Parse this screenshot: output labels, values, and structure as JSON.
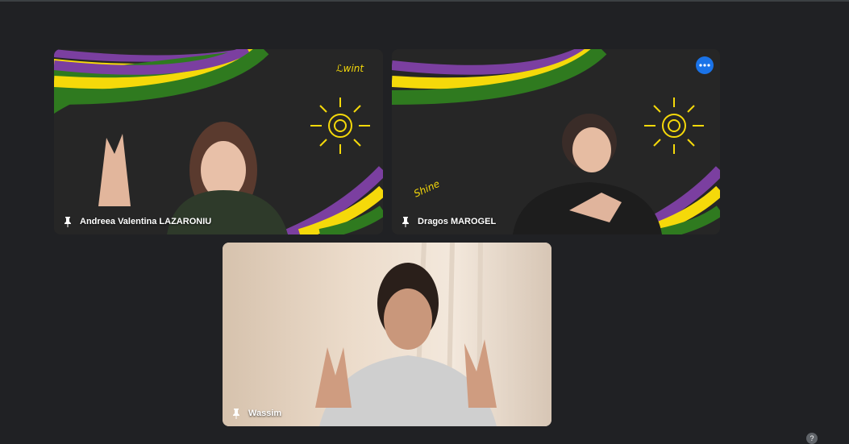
{
  "participants": [
    {
      "name": "Andreea Valentina LAZARONIU",
      "pinned": false
    },
    {
      "name": "Dragos MAROGEL",
      "pinned": false,
      "menu_icon": "more-options-icon"
    },
    {
      "name": "Wassim",
      "pinned": false
    }
  ],
  "colors": {
    "background": "#202124",
    "accent": "#1a73e8",
    "stripe_purple": "#7b3fa0",
    "stripe_yellow": "#f5d90a",
    "stripe_green": "#2f7a1f"
  },
  "icons": {
    "pin": "pin-icon",
    "more": "more-options-icon",
    "help": "help-icon"
  },
  "help_label": "?"
}
